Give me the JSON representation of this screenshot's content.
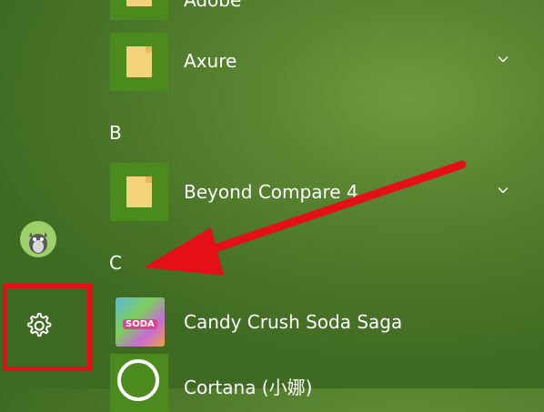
{
  "apps": [
    {
      "label": "Adobe",
      "icon": "folder-icon",
      "expandable": false
    },
    {
      "label": "Axure",
      "icon": "folder-icon",
      "expandable": true
    },
    {
      "label": "Beyond Compare 4",
      "icon": "folder-icon",
      "expandable": true
    },
    {
      "label": "Candy Crush Soda Saga",
      "icon": "candy-crush-icon"
    },
    {
      "label": "Cortana (小娜)",
      "icon": "cortana-icon"
    }
  ],
  "sections": {
    "b": "B",
    "c": "C"
  },
  "candy_tile_text": "SODA",
  "colors": {
    "highlight": "#e50f18",
    "tile": "#4b8a1d",
    "background": "#4a7528"
  }
}
